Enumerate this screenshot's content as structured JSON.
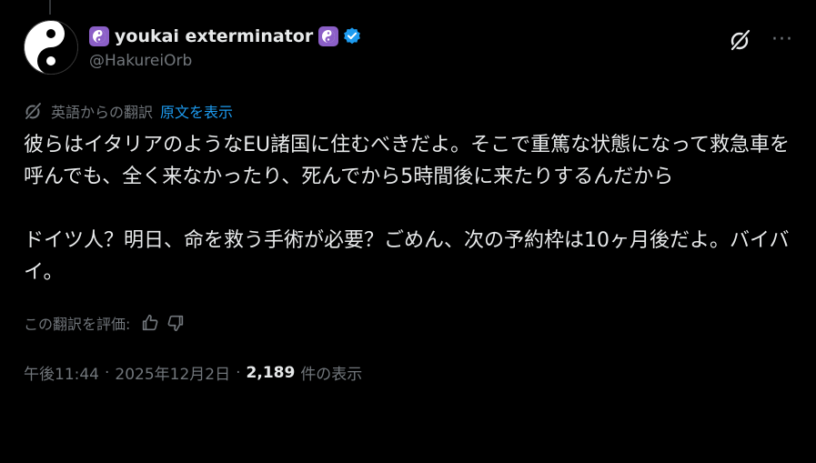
{
  "author": {
    "display_name": "youkai exterminator",
    "handle": "@HakureiOrb",
    "verified": true
  },
  "translation": {
    "label": "英語からの翻訳",
    "show_original": "原文を表示"
  },
  "body": {
    "paragraph1": "彼らはイタリアのようなEU諸国に住むべきだよ。そこで重篤な状態になって救急車を呼んでも、全く来なかったり、死んでから5時間後に来たりするんだから",
    "paragraph2": "ドイツ人？明日、命を救う手術が必要？ごめん、次の予約枠は10ヶ月後だよ。バイバイ。"
  },
  "rating": {
    "label": "この翻訳を評価:"
  },
  "meta": {
    "time": "午後11:44",
    "date": "2025年12月2日",
    "separator": "·",
    "views_count": "2,189",
    "views_label": "件の表示"
  },
  "icons": {
    "avatar": "yin-yang-avatar",
    "name_badge": "yin-yang-emoji",
    "verified": "verified-badge-icon",
    "grok": "grok-icon",
    "more": "more-icon",
    "translate": "translate-icon",
    "thumbs_up": "thumbs-up-icon",
    "thumbs_down": "thumbs-down-icon"
  },
  "colors": {
    "background": "#000000",
    "text_primary": "#e7e9ea",
    "text_secondary": "#71767b",
    "link": "#1d9bf0",
    "badge_purple": "#8b5fc7",
    "verified_blue": "#1d9bf0"
  }
}
